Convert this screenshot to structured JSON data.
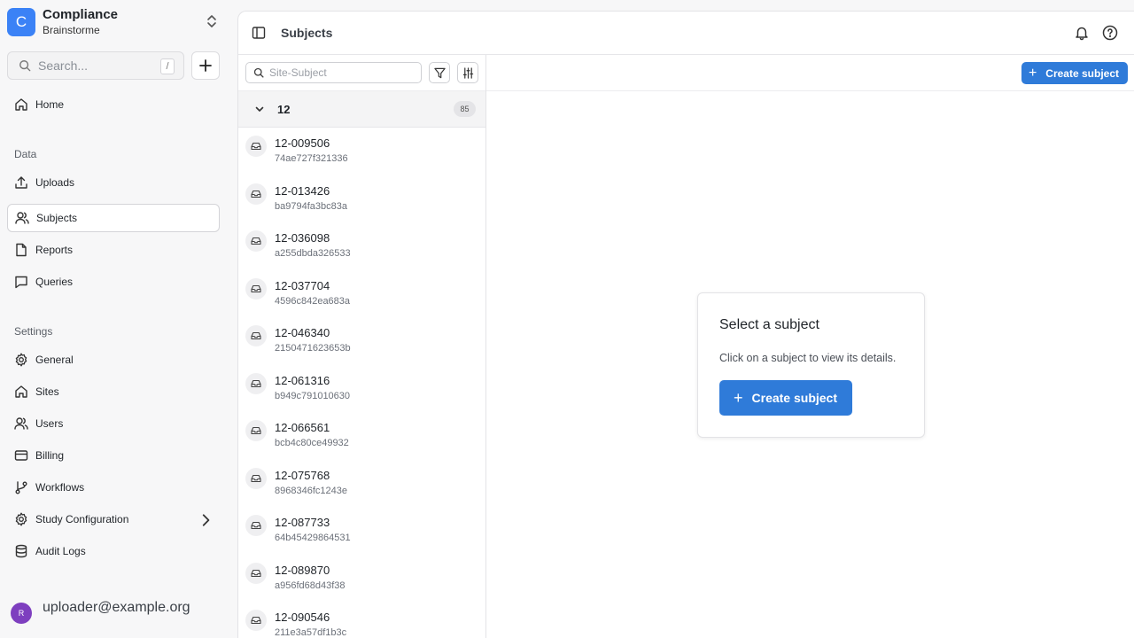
{
  "org": {
    "logo_letter": "C",
    "name": "Compliance",
    "subtitle": "Brainstorme"
  },
  "search": {
    "placeholder": "Search...",
    "shortcut": "/"
  },
  "nav": {
    "home": "Home",
    "data_section": "Data",
    "data_items": [
      {
        "label": "Uploads",
        "icon": "upload-icon"
      },
      {
        "label": "Subjects",
        "icon": "users-icon",
        "active": true
      },
      {
        "label": "Reports",
        "icon": "file-icon"
      },
      {
        "label": "Queries",
        "icon": "message-icon"
      }
    ],
    "settings_section": "Settings",
    "settings_items": [
      {
        "label": "General",
        "icon": "gear-icon"
      },
      {
        "label": "Sites",
        "icon": "home-icon"
      },
      {
        "label": "Users",
        "icon": "users-icon"
      },
      {
        "label": "Billing",
        "icon": "credit-card-icon"
      },
      {
        "label": "Workflows",
        "icon": "git-branch-icon"
      },
      {
        "label": "Study Configuration",
        "icon": "gear-icon"
      },
      {
        "label": "Audit Logs",
        "icon": "database-icon"
      }
    ]
  },
  "user": {
    "avatar_letter": "R",
    "email": "uploader@example.org"
  },
  "header": {
    "title": "Subjects"
  },
  "list": {
    "search_placeholder": "Site-Subject",
    "group": {
      "name": "12",
      "count": "85"
    },
    "rows": [
      {
        "id": "12-009506",
        "hash": "74ae727f321336"
      },
      {
        "id": "12-013426",
        "hash": "ba9794fa3bc83a"
      },
      {
        "id": "12-036098",
        "hash": "a255dbda326533"
      },
      {
        "id": "12-037704",
        "hash": "4596c842ea683a"
      },
      {
        "id": "12-046340",
        "hash": "2150471623653b"
      },
      {
        "id": "12-061316",
        "hash": "b949c791010630"
      },
      {
        "id": "12-066561",
        "hash": "bcb4c80ce49932"
      },
      {
        "id": "12-075768",
        "hash": "8968346fc1243e"
      },
      {
        "id": "12-087733",
        "hash": "64b45429864531"
      },
      {
        "id": "12-089870",
        "hash": "a956fd68d43f38"
      },
      {
        "id": "12-090546",
        "hash": "211e3a57df1b3c"
      }
    ]
  },
  "detail": {
    "create_button": "Create subject",
    "empty_title": "Select a subject",
    "empty_description": "Click on a subject to view its details.",
    "empty_create_button": "Create subject"
  },
  "colors": {
    "accent": "#2f7bd9",
    "org_logo": "#3b82f6",
    "avatar": "#7e3fbf"
  }
}
